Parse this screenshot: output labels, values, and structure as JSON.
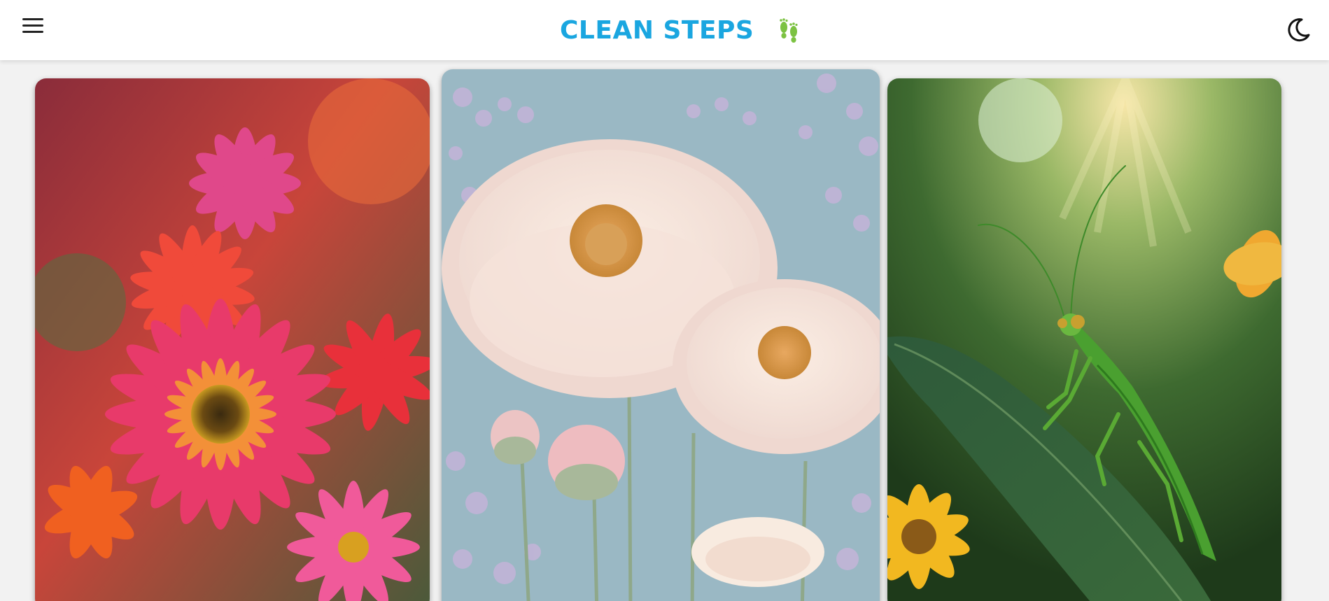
{
  "header": {
    "title": "CLEAN STEPS",
    "brand_icon": "footprints-icon",
    "menu_icon": "hamburger-menu-icon",
    "theme_icon": "moon-icon",
    "colors": {
      "title": "#1aa6e0",
      "footprints": "#7cc242",
      "topbar_bg": "#ffffff",
      "page_bg": "#f2f2f2"
    }
  },
  "gallery": {
    "cards": [
      {
        "subject": "pink-and-orange-daisies"
      },
      {
        "subject": "pastel-peonies-illustration"
      },
      {
        "subject": "praying-mantis-on-leaf"
      }
    ]
  }
}
